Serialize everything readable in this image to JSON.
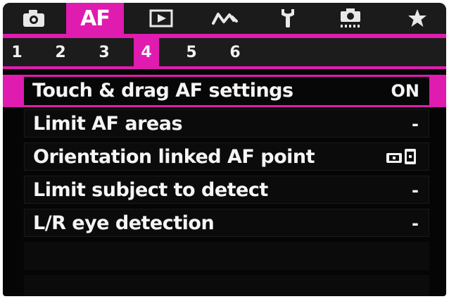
{
  "tabs": [
    {
      "id": "shooting",
      "icon": "camera-icon",
      "label": ""
    },
    {
      "id": "af",
      "icon": "",
      "label": "AF",
      "active": true
    },
    {
      "id": "playback",
      "icon": "play-icon",
      "label": ""
    },
    {
      "id": "wireless",
      "icon": "wireless-icon",
      "label": ""
    },
    {
      "id": "setup",
      "icon": "wrench-icon",
      "label": ""
    },
    {
      "id": "custom-functions",
      "icon": "custom-camera-icon",
      "label": ""
    },
    {
      "id": "my-menu",
      "icon": "star-icon",
      "label": ""
    }
  ],
  "pages": [
    "1",
    "2",
    "3",
    "4",
    "5",
    "6"
  ],
  "active_page": "4",
  "menu": {
    "items": [
      {
        "label": "Touch & drag AF settings",
        "value": "ON",
        "selected": true
      },
      {
        "label": "Limit AF areas",
        "value": "-"
      },
      {
        "label": "Orientation linked AF point",
        "value": "",
        "value_icon": "orientation-icon"
      },
      {
        "label": "Limit subject to detect",
        "value": "-"
      },
      {
        "label": "L/R eye detection",
        "value": "-"
      }
    ]
  },
  "colors": {
    "accent": "#e01bb0",
    "background": "#050505",
    "text": "#f5f5f5"
  }
}
